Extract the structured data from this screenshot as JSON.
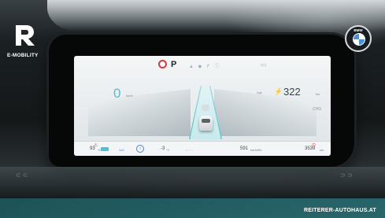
{
  "branding": {
    "logo_letter": "R",
    "logo_caption": "E-MOBILITY",
    "car_brand_letters": "BMW",
    "website": "REITERER-AUTOHAUS.AT"
  },
  "cluster": {
    "gear": "P",
    "speed": "0",
    "speed_unit": "km/h",
    "range": "322",
    "range_unit": "km",
    "right_label_top": "Age",
    "right_label_mode": "CHG",
    "left_value": "93",
    "left_value_unit": "%",
    "assist_label": "1z3",
    "temp_value": "-3",
    "temp_unit": "°C",
    "trip_value": "591",
    "trip_unit": "km/kWh",
    "odometer": "3539",
    "odometer_unit": "km"
  },
  "colors": {
    "accent": "#4fc0d3",
    "warning": "#d23b3b",
    "url_band": "#1f787d"
  }
}
